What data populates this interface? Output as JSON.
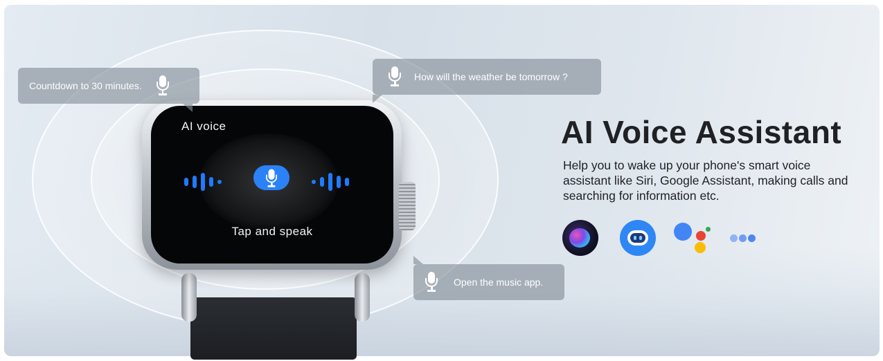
{
  "watch_screen": {
    "title": "AI voice",
    "subtitle": "Tap and speak"
  },
  "bubbles": [
    {
      "text": "Countdown to 30 minutes."
    },
    {
      "text": "How will the weather be tomorrow ?"
    },
    {
      "text": "Open the music app."
    }
  ],
  "headline": "AI Voice Assistant",
  "description": "Help you to wake up your phone's smart voice assistant like Siri, Google Assistant, making calls and searching for information etc.",
  "assistant_icons": [
    "siri-icon",
    "robot-assistant-icon",
    "google-assistant-icon",
    "more-dots-icon"
  ],
  "colors": {
    "accent_blue": "#2b82f7",
    "bubble_bg": "#828c96",
    "headline": "#1f2124"
  }
}
